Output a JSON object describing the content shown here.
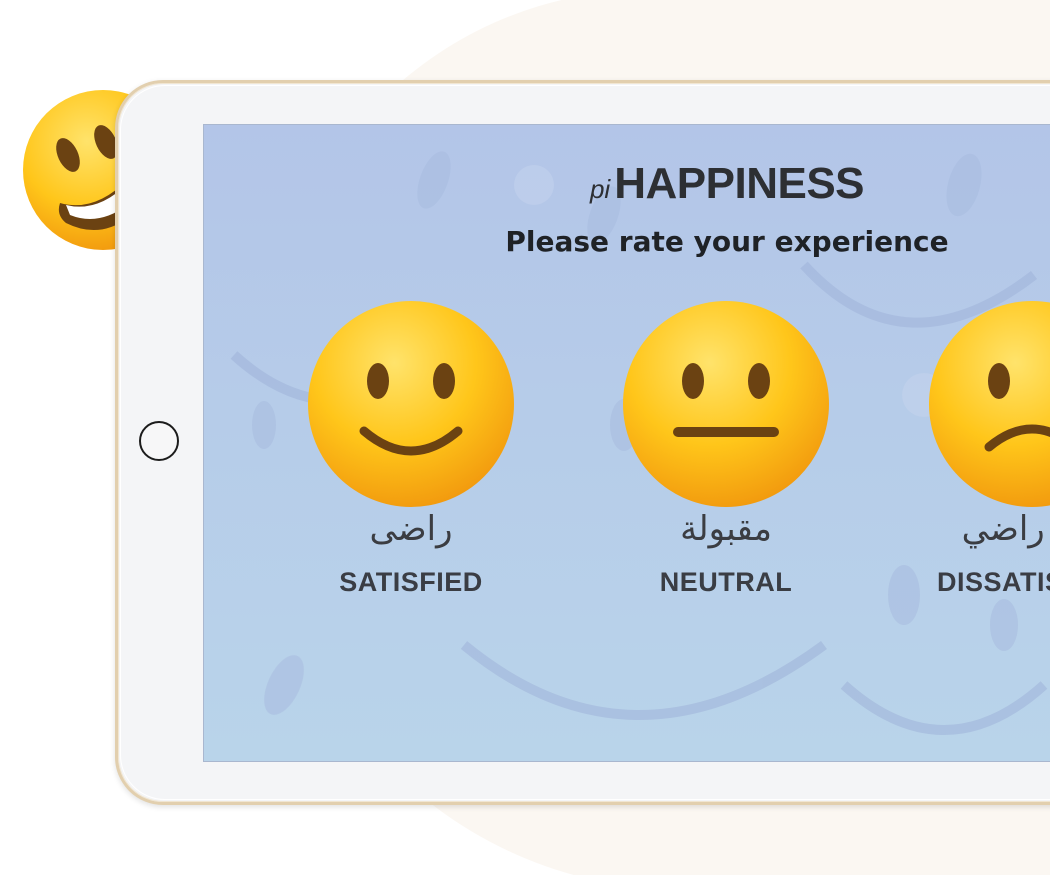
{
  "header": {
    "brand_prefix": "pi",
    "brand_name": "HAPPINESS",
    "prompt": "Please rate your experience"
  },
  "ratings": [
    {
      "arabic": "راضى",
      "label": "SATISFIED",
      "face_icon": "slightly-smiling-face-icon"
    },
    {
      "arabic": "مقبولة",
      "label": "NEUTRAL",
      "face_icon": "neutral-face-icon"
    },
    {
      "arabic": "غير راضي",
      "label": "DISSATISFIED",
      "face_icon": "slightly-frowning-face-icon"
    }
  ],
  "decoration": {
    "corner_emoji_icon": "grinning-face-icon"
  },
  "colors": {
    "emoji_yellow": "#FFC61A",
    "emoji_shade": "#F29A0E",
    "feature_brown": "#6B4212",
    "screen_blue": "#B5CAE9",
    "tablet_frame": "#F4F5F7",
    "tablet_gold_edge": "#E2CFAE",
    "text_dark": "#2D2F33"
  }
}
